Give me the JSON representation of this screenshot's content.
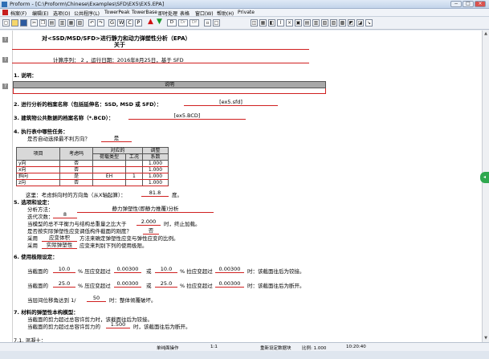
{
  "window": {
    "title": "Proform - [C:\\Proform\\Chinese\\Examples\\SFD\\EX5\\EX5.EPA]",
    "controls": [
      "−",
      "□",
      "×"
    ]
  },
  "menu": [
    "档案(F)",
    "编辑(E)",
    "选项(O)",
    "公共程序(L)",
    "TowerPeak",
    "TowerBase",
    "即时处理",
    "表格",
    "窗口(W)",
    "帮助(H)",
    "Private"
  ],
  "toolbar": {
    "gwcp": [
      "G",
      "W",
      "C",
      "P"
    ],
    "icons": [
      "new-icon",
      "open-icon",
      "save-icon",
      "cut-icon",
      "copy-icon",
      "paste-icon",
      "print-icon",
      "preview-icon",
      "undo-icon",
      "redo-icon",
      "run-icon",
      "warning-icon",
      "down-arrow-icon",
      "do-icon",
      "dr-icon",
      "df-icon"
    ]
  },
  "doc": {
    "title": "对<SSD/MSD/SFD>进行静力和动力弹塑性分析（EPA）",
    "title2": "关于",
    "calc_line": "计算序列：   2    ，运行日期：2016年8月25日，基于 SFD",
    "s1": "1. 说明：",
    "s1_banner": "说明",
    "s2": "2. 进行分析的档案名称（包括延伸名：SSD, MSD 或 SFD）：",
    "s2_val": "[ex5.sfd]",
    "s3": "3. 建筑物公共数据的档案名称（*.BCD）：",
    "s3_val": "[ex5.BCD]",
    "s4": "4. 执行表中哪些任务：",
    "s4_q": "是否自动选择最不利方向？",
    "s4_q_val": "是",
    "table": {
      "headers": [
        "项目",
        "考虑吗",
        "对应的",
        "调整"
      ],
      "sub": [
        "荷载类型",
        "工况",
        "系数"
      ],
      "rows": [
        [
          "y向",
          "否",
          "",
          "",
          "1.000"
        ],
        [
          "x向",
          "否",
          "",
          "",
          "1.000"
        ],
        [
          "斜向",
          "是",
          "EH",
          "1",
          "1.000"
        ],
        [
          "z向",
          "否",
          "",
          "",
          "1.000"
        ]
      ]
    },
    "s4_angle_lbl": "这里：考虑斜向时的方向角（从X轴起算）：",
    "s4_angle_val": "81.8",
    "s4_angle_unit": "度。",
    "s5": "5. 选项和设定：",
    "s5_method_lbl": "分析方法：",
    "s5_method_val": "静力弹塑性(即静力推覆)分析",
    "s5_iter_lbl": "迭代次数：",
    "s5_iter_val": "8",
    "s5_stop_lbl": "当模型的总不平衡力与结构总重量之比大于",
    "s5_stop_val": "2.000",
    "s5_stop_suffix": "时，终止加载。",
    "s5_check_lbl": "是否按实际弹塑性应变调低构件截面的刚度？",
    "s5_check_val": "否",
    "s5_use1_pre": "采用",
    "s5_use1_val": "应变体积",
    "s5_use1_suffix": "方法来确定弹塑性应变与弹性应变的比例。",
    "s5_use2_pre": "采用",
    "s5_use2_val": "实际弹塑性",
    "s5_use2_suffix": "应变来判别下列的使用极限。",
    "s6": "6. 使用极限设定：",
    "s6_l1": {
      "p1": "当截面的",
      "v1": "10.0",
      "p2": "% 压应变超过",
      "v2": "0.00300",
      "p3": "或",
      "v3": "10.0",
      "p4": "% 拉应变超过",
      "v4": "0.00300",
      "p5": "时：该截面往后为铰接。"
    },
    "s6_l2": {
      "p1": "当截面的",
      "v1": "25.0",
      "p2": "% 压应变超过",
      "v2": "0.00300",
      "p3": "或",
      "v3": "25.0",
      "p4": "% 拉应变超过",
      "v4": "0.00300",
      "p5": "时：该截面往后为断开。"
    },
    "s6_l3": {
      "p1": "当层间位移角达到 1/",
      "v1": "50",
      "p2": "时：整体倾覆破坏。"
    },
    "s7": "7. 材料的弹塑性本构模型：",
    "s7_l1": "当截面的剪力超过总容许剪力时，该截面往后为铰接。",
    "s7_l2_pre": "当截面的剪力超过总容许剪力的",
    "s7_l2_val": "1.500",
    "s7_l2_suffix": "时，该截面往后为断开。",
    "s71": "7.1. 混凝土："
  },
  "status": {
    "mode": "单纯面操作",
    "ratio": "1:1",
    "action": "重新设定数据块",
    "zoom": "比例: 1.000",
    "time": "10:20:40"
  }
}
